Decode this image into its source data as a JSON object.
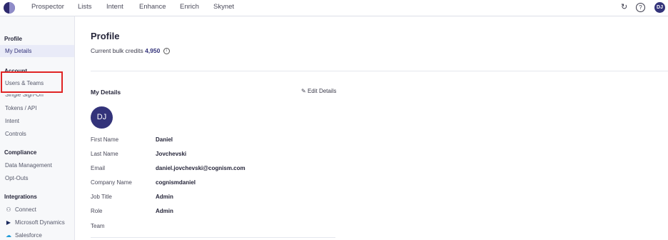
{
  "topbar": {
    "nav": [
      "Prospector",
      "Lists",
      "Intent",
      "Enhance",
      "Enrich",
      "Skynet"
    ],
    "user_initials": "DJ",
    "icons": [
      "logo-icon",
      "refresh-icon",
      "help-icon"
    ]
  },
  "sidebar": {
    "profile_heading": "Profile",
    "profile_items": [
      "My Details"
    ],
    "account_heading": "Account",
    "account_items": [
      "Users & Teams",
      "Single Sign-On",
      "Tokens / API",
      "Intent",
      "Controls"
    ],
    "compliance_heading": "Compliance",
    "compliance_items": [
      "Data Management",
      "Opt-Outs"
    ],
    "integrations_heading": "Integrations",
    "integration_items": [
      {
        "label": "Connect",
        "icon": "connect-icon"
      },
      {
        "label": "Microsoft Dynamics",
        "icon": "dynamics-icon"
      },
      {
        "label": "Salesforce",
        "icon": "salesforce-icon"
      }
    ]
  },
  "main": {
    "title": "Profile",
    "credits_label": "Current bulk credits",
    "credits_value": "4,950",
    "section_title": "My Details",
    "edit_label": "Edit Details",
    "avatar_initials": "DJ",
    "fields": [
      {
        "label": "First Name",
        "value": "Daniel"
      },
      {
        "label": "Last Name",
        "value": "Jovchevski"
      },
      {
        "label": "Email",
        "value": "daniel.jovchevski@cognism.com"
      },
      {
        "label": "Company Name",
        "value": "cognismdaniel"
      },
      {
        "label": "Job Title",
        "value": "Admin"
      },
      {
        "label": "Role",
        "value": "Admin"
      },
      {
        "label": "Team",
        "value": ""
      }
    ]
  },
  "colors": {
    "accent": "#33337a",
    "highlight": "#e02424"
  }
}
